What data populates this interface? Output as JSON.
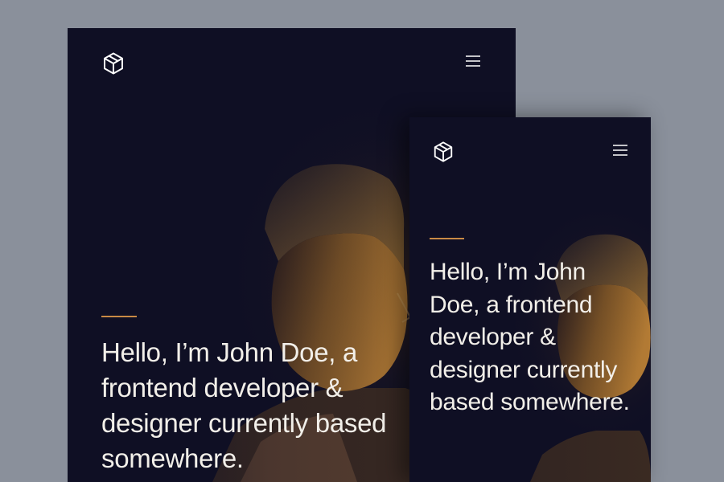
{
  "colors": {
    "page_background": "#8a909b",
    "screen_background": "#0f0f24",
    "accent": "#c98a45",
    "text": "#f2efe9"
  },
  "icons": {
    "logo": "cube-icon",
    "menu": "hamburger-menu-icon"
  },
  "screens": [
    {
      "device": "tablet",
      "headline": "Hello, I’m John Doe, a frontend developer & designer currently based somewhere."
    },
    {
      "device": "mobile",
      "headline": "Hello, I’m John Doe, a frontend developer & designer currently based somewhere."
    }
  ]
}
